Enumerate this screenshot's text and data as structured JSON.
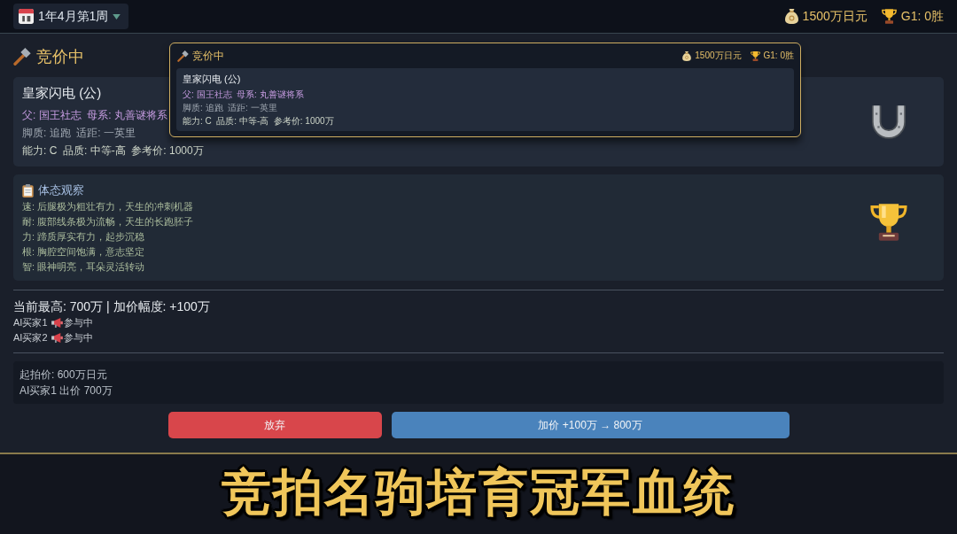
{
  "top_bar": {
    "date": "1年4月第1周",
    "money": "1500万日元",
    "g1_wins": "G1: 0胜"
  },
  "heading": "竞价中",
  "horse_card": {
    "name": "皇家闪电 (公)",
    "lines": [
      {
        "kind": "pedigree",
        "text": "父: 国王社志  母系: 丸善谜将系"
      },
      {
        "kind": "aptitude",
        "text": "脚质: 追跑  适距: 一英里"
      },
      {
        "kind": "stats",
        "text": "能力: C  品质: 中等-高  参考价: 1000万"
      }
    ]
  },
  "observation": {
    "title": "体态观察",
    "lines": [
      "速: 后腿极为粗壮有力，天生的冲刺机器",
      "耐: 腹部线条极为流畅，天生的长跑胚子",
      "力: 蹄质厚实有力，起步沉稳",
      "根: 胸腔空间饱满，意志坚定",
      "智: 眼神明亮，耳朵灵活转动"
    ]
  },
  "bid_status": "当前最高: 700万  |  加价幅度: +100万",
  "bidders": [
    {
      "name": "AI买家1",
      "status": "参与中"
    },
    {
      "name": "AI买家2",
      "status": "参与中"
    }
  ],
  "bid_log": [
    "起拍价: 600万日元",
    "AI买家1 出价 700万"
  ],
  "buttons": [
    {
      "kind": "danger",
      "label": "放弃"
    },
    {
      "kind": "primary",
      "label": "加价 +100万 → 800万"
    }
  ],
  "popup": {
    "heading": "竞价中",
    "money": "1500万日元",
    "g1_wins": "G1: 0胜",
    "horse_card": {
      "name": "皇家闪电 (公)",
      "lines": [
        {
          "kind": "pedigree",
          "text": "父: 国王社志  母系: 丸善谜将系"
        },
        {
          "kind": "aptitude",
          "text": "脚质: 追跑  适距: 一英里"
        },
        {
          "kind": "stats",
          "text": "能力: C  品质: 中等-高  参考价: 1000万"
        }
      ]
    }
  },
  "caption": "竞拍名驹培育冠军血统"
}
